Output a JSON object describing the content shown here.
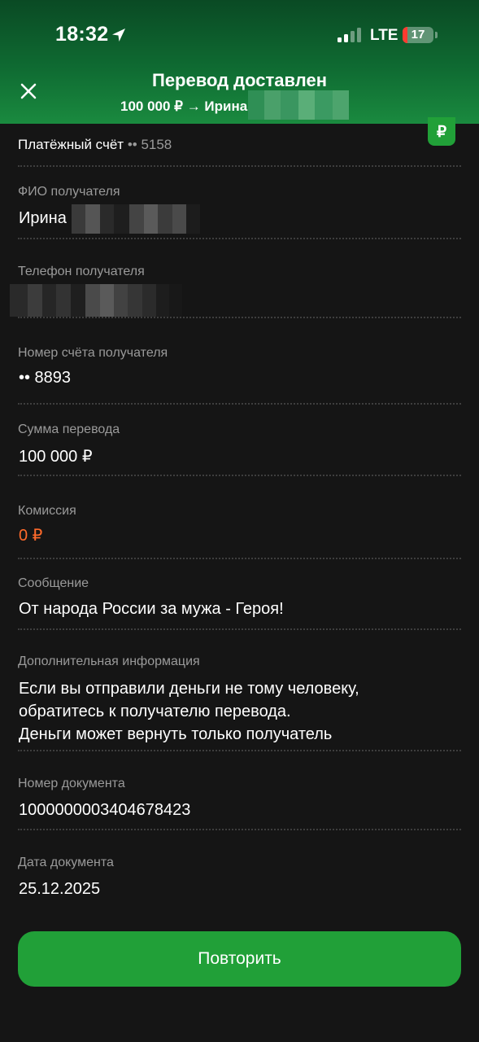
{
  "status_bar": {
    "time": "18:32",
    "network": "LTE",
    "battery": "17",
    "battery_level": 0.17,
    "icons": [
      "location-arrow-icon",
      "signal-icon",
      "battery-icon"
    ]
  },
  "header": {
    "title": "Перевод доставлен",
    "subtitle": "100 000 ₽ → Ирина",
    "close_icon": "close-icon",
    "badge": "₽"
  },
  "account": {
    "label": "Платёжный счёт",
    "number": "•• 5158"
  },
  "fields": {
    "recipient_name": {
      "label": "ФИО получателя",
      "value": "Ирина"
    },
    "recipient_phone": {
      "label": "Телефон получателя"
    },
    "account_number": {
      "label": "Номер счёта получателя",
      "value": "•• 8893"
    },
    "amount": {
      "label": "Сумма перевода",
      "value": "100 000 ₽"
    },
    "commission": {
      "label": "Комиссия",
      "value": "0 ₽"
    },
    "message": {
      "label": "Сообщение",
      "value": "От народа России за мужа - Героя!"
    },
    "additional_info": {
      "label": "Дополнительная информация",
      "lines": [
        "Если вы отправили деньги не тому человеку,",
        "обратитесь к получателю перевода.",
        "Деньги может вернуть только получатель"
      ]
    },
    "document_number": {
      "label": "Номер документа",
      "value": "1000000003404678423"
    },
    "document_date": {
      "label": "Дата документа",
      "value": "25.12.2025"
    }
  },
  "actions": {
    "repeat_label": "Повторить"
  },
  "colors": {
    "accent": "#21a038",
    "commission": "#ff6a2b",
    "background": "#151515",
    "label": "#9a9a9a"
  }
}
